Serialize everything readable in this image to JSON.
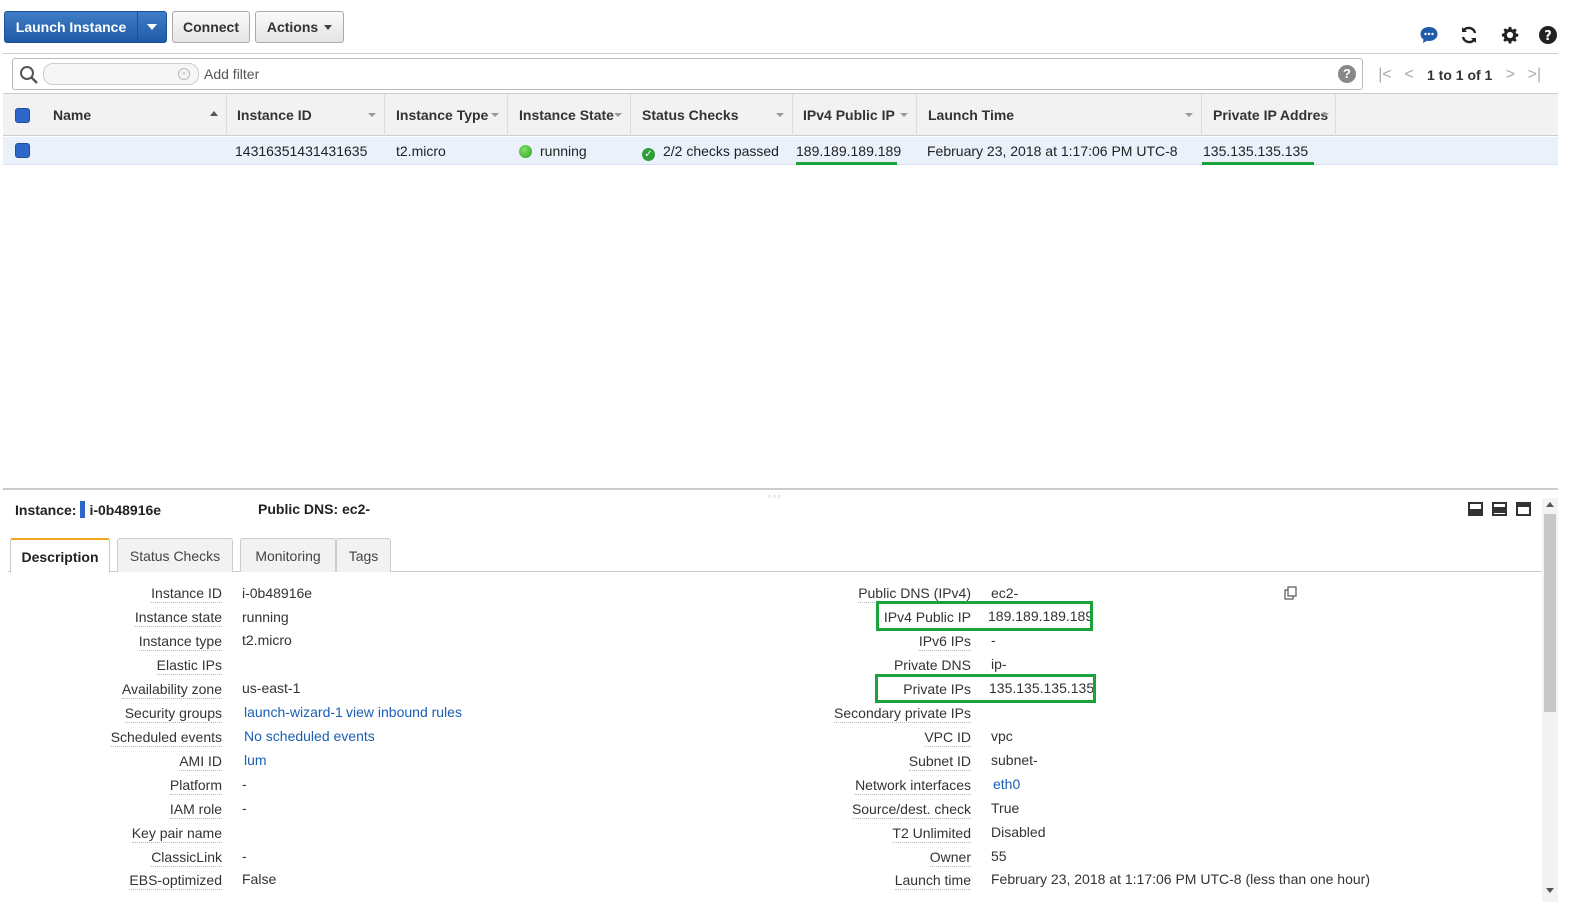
{
  "toolbar": {
    "launch_label": "Launch Instance",
    "connect_label": "Connect",
    "actions_label": "Actions",
    "icons": [
      "chat-icon",
      "refresh-icon",
      "gear-icon",
      "help-icon"
    ]
  },
  "filter": {
    "search_value": "",
    "add_filter_placeholder": "Add filter",
    "help": "?",
    "pager_text": "1 to 1 of 1"
  },
  "grid": {
    "columns": [
      "Name",
      "Instance ID",
      "Instance Type",
      "Instance State",
      "Status Checks",
      "IPv4 Public IP",
      "Launch Time",
      "Private IP Addres"
    ],
    "row": {
      "name": "",
      "instance_id": "14316351431431635",
      "instance_type": "t2.micro",
      "instance_state": "running",
      "status_checks": "2/2 checks passed",
      "ipv4_public_ip": "189.189.189.189",
      "launch_time": "February 23, 2018 at 1:17:06 PM UTC-8",
      "private_ip": "135.135.135.135"
    }
  },
  "details": {
    "instance_label": "Instance:",
    "instance_id": "i-0b48916e",
    "public_dns_label": "Public DNS: ec2-",
    "tabs": [
      "Description",
      "Status Checks",
      "Monitoring",
      "Tags"
    ],
    "left": [
      {
        "k": "Instance ID",
        "v": "i-0b48916e"
      },
      {
        "k": "Instance state",
        "v": "running"
      },
      {
        "k": "Instance type",
        "v": "t2.micro"
      },
      {
        "k": "Elastic IPs",
        "v": ""
      },
      {
        "k": "Availability zone",
        "v": "us-east-1"
      },
      {
        "k": "Security groups",
        "v": "launch-wizard-1 .",
        "link2": "view inbound rules"
      },
      {
        "k": "Scheduled events",
        "v": "No scheduled events"
      },
      {
        "k": "AMI ID",
        "v": "lum"
      },
      {
        "k": "Platform",
        "v": "-"
      },
      {
        "k": "IAM role",
        "v": "-"
      },
      {
        "k": "Key pair name",
        "v": ""
      },
      {
        "k": "ClassicLink",
        "v": "-"
      },
      {
        "k": "EBS-optimized",
        "v": "False"
      }
    ],
    "right": [
      {
        "k": "Public DNS (IPv4)",
        "v": "ec2-"
      },
      {
        "k": "IPv4 Public IP",
        "v": "189.189.189.189"
      },
      {
        "k": "IPv6 IPs",
        "v": "-"
      },
      {
        "k": "Private DNS",
        "v": "ip-"
      },
      {
        "k": "Private IPs",
        "v": "135.135.135.135"
      },
      {
        "k": "Secondary private IPs",
        "v": ""
      },
      {
        "k": "VPC ID",
        "v": "vpc"
      },
      {
        "k": "Subnet ID",
        "v": "subnet-"
      },
      {
        "k": "Network interfaces",
        "v": "eth0"
      },
      {
        "k": "Source/dest. check",
        "v": "True"
      },
      {
        "k": "T2 Unlimited",
        "v": "Disabled"
      },
      {
        "k": "Owner",
        "v": "55"
      },
      {
        "k": "Launch time",
        "v": "February 23, 2018 at 1:17:06 PM UTC-8 (less than one hour)"
      }
    ]
  },
  "colors": {
    "accent": "#2f66c9",
    "highlight": "#1aa33a",
    "tab_active": "#f0a31c"
  }
}
